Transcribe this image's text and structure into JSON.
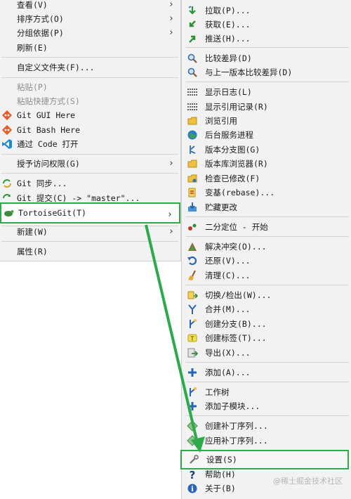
{
  "context_menu": {
    "items": [
      {
        "label": "查看(V)",
        "arrow": true
      },
      {
        "label": "排序方式(O)",
        "arrow": true
      },
      {
        "label": "分组依据(P)",
        "arrow": true
      },
      {
        "label": "刷新(E)"
      },
      {
        "label": "自定义文件夹(F)..."
      },
      {
        "label": "粘贴(P)",
        "disabled": true
      },
      {
        "label": "粘贴快捷方式(S)",
        "disabled": true
      },
      {
        "label": "Git GUI Here",
        "icon": "git-gui-icon"
      },
      {
        "label": "Git Bash Here",
        "icon": "git-bash-icon"
      },
      {
        "label": "通过 Code 打开",
        "icon": "vscode-icon"
      },
      {
        "label": "授予访问权限(G)",
        "arrow": true
      },
      {
        "label": "Git 同步...",
        "icon": "git-sync-icon"
      },
      {
        "label": "Git 提交(C) -> \"master\"...",
        "icon": "git-commit-icon"
      },
      {
        "label": "TortoiseGit(T)",
        "arrow": true,
        "icon": "tortoisegit-icon"
      },
      {
        "label": "新建(W)",
        "arrow": true
      },
      {
        "label": "属性(R)"
      }
    ]
  },
  "submenu": {
    "items": [
      {
        "label": "拉取(P)...",
        "icon": "pull-icon"
      },
      {
        "label": "获取(E)...",
        "icon": "fetch-icon"
      },
      {
        "label": "推送(H)...",
        "icon": "push-icon"
      },
      {
        "label": "比较差异(D)",
        "icon": "diff-icon"
      },
      {
        "label": "与上一版本比较差异(D)",
        "icon": "diff-previous-icon"
      },
      {
        "label": "显示日志(L)",
        "icon": "log-icon"
      },
      {
        "label": "显示引用记录(R)",
        "icon": "reflog-icon"
      },
      {
        "label": "浏览引用",
        "icon": "browse-refs-icon"
      },
      {
        "label": "后台服务进程",
        "icon": "daemon-icon"
      },
      {
        "label": "版本分支图(G)",
        "icon": "revision-graph-icon"
      },
      {
        "label": "版本库浏览器(R)",
        "icon": "repo-browser-icon"
      },
      {
        "label": "检查已修改(F)",
        "icon": "check-modifications-icon"
      },
      {
        "label": "变基(rebase)...",
        "icon": "rebase-icon"
      },
      {
        "label": "贮藏更改",
        "icon": "stash-icon"
      },
      {
        "label": "二分定位 - 开始",
        "icon": "bisect-icon"
      },
      {
        "label": "解决冲突(O)...",
        "icon": "resolve-icon"
      },
      {
        "label": "还原(V)...",
        "icon": "revert-icon"
      },
      {
        "label": "清理(C)...",
        "icon": "cleanup-icon"
      },
      {
        "label": "切换/检出(W)...",
        "icon": "switch-icon"
      },
      {
        "label": "合并(M)...",
        "icon": "merge-icon"
      },
      {
        "label": "创建分支(B)...",
        "icon": "branch-icon"
      },
      {
        "label": "创建标签(T)...",
        "icon": "tag-icon"
      },
      {
        "label": "导出(X)...",
        "icon": "export-icon"
      },
      {
        "label": "添加(A)...",
        "icon": "add-icon"
      },
      {
        "label": "工作树",
        "icon": "worktree-icon"
      },
      {
        "label": "添加子模块...",
        "icon": "add-submodule-icon"
      },
      {
        "label": "创建补丁序列...",
        "icon": "create-patch-icon"
      },
      {
        "label": "应用补丁序列...",
        "icon": "apply-patch-icon"
      },
      {
        "label": "设置(S)",
        "icon": "settings-icon"
      },
      {
        "label": "帮助(H)",
        "icon": "help-icon"
      },
      {
        "label": "关于(B)",
        "icon": "about-icon"
      }
    ]
  },
  "watermark": "@稀土掘金技术社区",
  "colors": {
    "highlight": "#2eaa4a",
    "menu_bg": "#f2f2f2",
    "separator": "#d3d3d3"
  }
}
